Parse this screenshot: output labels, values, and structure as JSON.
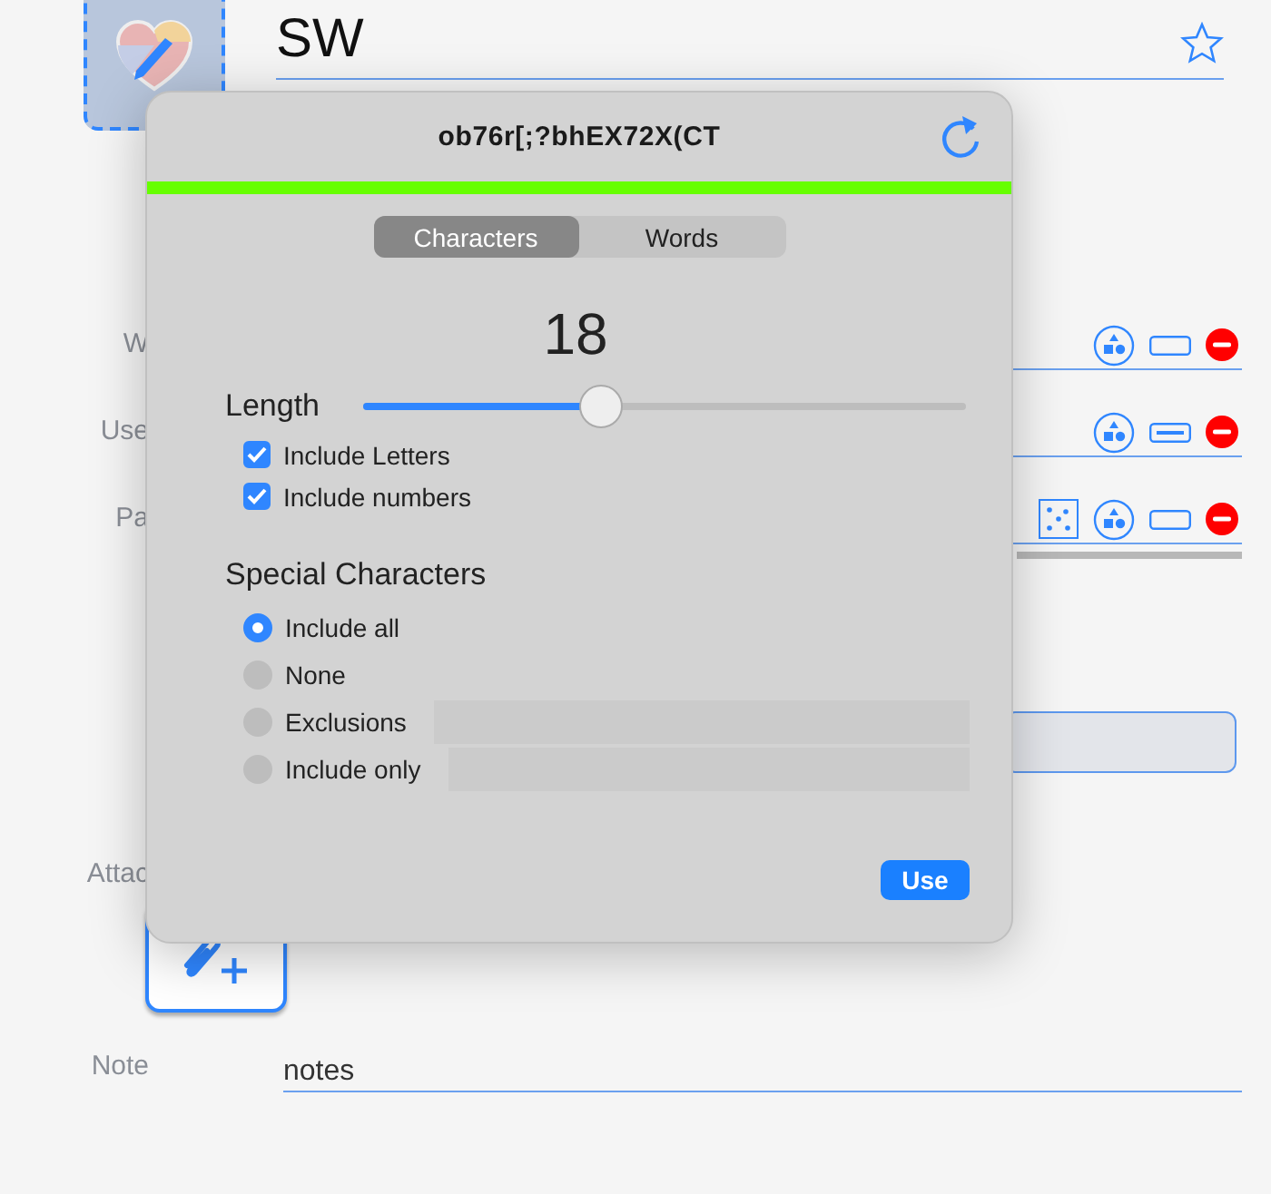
{
  "entry": {
    "title": "SW",
    "favorite": false
  },
  "fields": [
    {
      "label": "W",
      "kind": "plain",
      "dice": false
    },
    {
      "label": "Use",
      "kind": "filled",
      "dice": false
    },
    {
      "label": "Pa",
      "kind": "plain",
      "dice": true
    }
  ],
  "attachments": {
    "label": "Attac"
  },
  "note": {
    "label": "Note",
    "value": "notes"
  },
  "generator": {
    "password": "ob76r[;?bhEX72X(CT",
    "strength": {
      "level": 1,
      "color": "#66ff00"
    },
    "modes": [
      {
        "label": "Characters",
        "selected": true
      },
      {
        "label": "Words",
        "selected": false
      }
    ],
    "length": {
      "value": "18",
      "label": "Length",
      "level": 0.395
    },
    "options": [
      {
        "label": "Include Letters",
        "checked": true
      },
      {
        "label": "Include numbers",
        "checked": true
      }
    ],
    "special": {
      "title": "Special Characters",
      "choices": [
        {
          "label": "Include all",
          "selected": true,
          "kind": "plain"
        },
        {
          "label": "None",
          "selected": false,
          "kind": "plain"
        },
        {
          "label": "Exclusions",
          "selected": false,
          "kind": "field"
        },
        {
          "label": "Include only",
          "selected": false,
          "kind": "field"
        }
      ]
    },
    "use_button": "Use"
  }
}
